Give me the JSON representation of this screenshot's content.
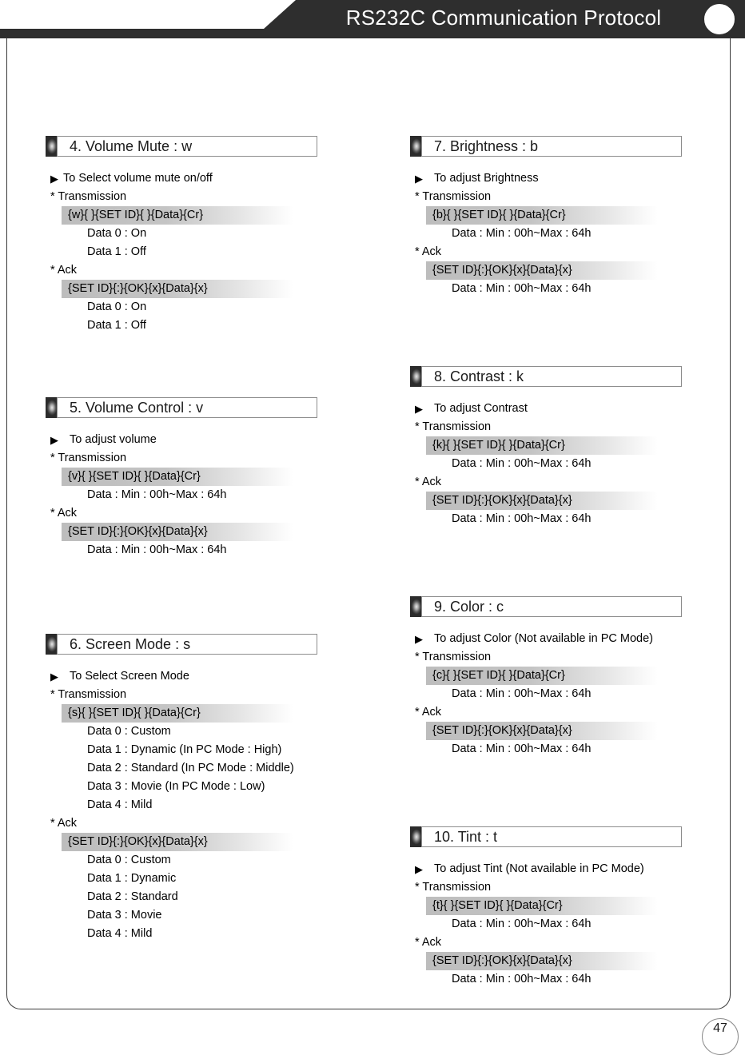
{
  "header": {
    "title": "RS232C Communication Protocol",
    "circle_icon": "circle-icon"
  },
  "page_number": "47",
  "left_column": [
    {
      "heading": "4. Volume Mute : w",
      "arrow_icon": "▶",
      "purpose": "To Select volume mute on/off",
      "transmission_label": "* Transmission",
      "transmission_command": "{w}{ }{SET ID}{ }{Data}{Cr}",
      "transmission_data": [
        "Data 0 : On",
        "Data 1 : Off"
      ],
      "ack_label": "* Ack",
      "ack_command": "{SET ID}{:}{OK}{x}{Data}{x}",
      "ack_data": [
        "Data 0 : On",
        "Data 1 : Off"
      ]
    },
    {
      "heading": "5. Volume Control : v",
      "arrow_icon": "▶",
      "purpose": "To adjust volume",
      "transmission_label": "* Transmission",
      "transmission_command": "{v}{ }{SET ID}{ }{Data}{Cr}",
      "transmission_data": [
        "Data : Min : 00h~Max : 64h"
      ],
      "ack_label": "* Ack",
      "ack_command": "{SET ID}{:}{OK}{x}{Data}{x}",
      "ack_data": [
        "Data : Min : 00h~Max : 64h"
      ]
    },
    {
      "heading": "6. Screen Mode : s",
      "arrow_icon": "▶",
      "purpose": "To Select Screen Mode",
      "transmission_label": "* Transmission",
      "transmission_command": "{s}{ }{SET ID}{ }{Data}{Cr}",
      "transmission_data": [
        "Data 0 : Custom",
        "Data 1 : Dynamic (In PC Mode : High)",
        "Data 2 : Standard (In PC Mode : Middle)",
        "Data 3 : Movie (In PC Mode : Low)",
        "Data 4 : Mild"
      ],
      "ack_label": "* Ack",
      "ack_command": "{SET ID}{:}{OK}{x}{Data}{x}",
      "ack_data": [
        "Data 0 : Custom",
        "Data 1 : Dynamic",
        "Data 2 : Standard",
        "Data 3 : Movie",
        "Data 4 : Mild"
      ]
    }
  ],
  "right_column": [
    {
      "heading": "7. Brightness : b",
      "arrow_icon": "▶",
      "purpose": "To adjust Brightness",
      "transmission_label": "* Transmission",
      "transmission_command": "{b}{ }{SET ID}{ }{Data}{Cr}",
      "transmission_data": [
        "Data : Min : 00h~Max : 64h"
      ],
      "ack_label": "* Ack",
      "ack_command": "{SET ID}{:}{OK}{x}{Data}{x}",
      "ack_data": [
        "Data : Min : 00h~Max : 64h"
      ]
    },
    {
      "heading": "8. Contrast : k",
      "arrow_icon": "▶",
      "purpose": "To adjust Contrast",
      "transmission_label": "* Transmission",
      "transmission_command": "{k}{ }{SET ID}{ }{Data}{Cr}",
      "transmission_data": [
        "Data : Min : 00h~Max : 64h"
      ],
      "ack_label": "* Ack",
      "ack_command": "{SET ID}{:}{OK}{x}{Data}{x}",
      "ack_data": [
        "Data : Min : 00h~Max : 64h"
      ]
    },
    {
      "heading": "9. Color : c",
      "arrow_icon": "▶",
      "purpose": "To adjust Color (Not available in PC Mode)",
      "transmission_label": "* Transmission",
      "transmission_command": "{c}{ }{SET ID}{ }{Data}{Cr}",
      "transmission_data": [
        "Data : Min : 00h~Max : 64h"
      ],
      "ack_label": "* Ack",
      "ack_command": "{SET ID}{:}{OK}{x}{Data}{x}",
      "ack_data": [
        "Data : Min : 00h~Max : 64h"
      ]
    },
    {
      "heading": "10. Tint : t",
      "arrow_icon": "▶",
      "purpose": "To adjust Tint (Not available in PC Mode)",
      "transmission_label": "* Transmission",
      "transmission_command": "{t}{ }{SET ID}{ }{Data}{Cr}",
      "transmission_data": [
        "Data : Min : 00h~Max : 64h"
      ],
      "ack_label": "* Ack",
      "ack_command": "{SET ID}{:}{OK}{x}{Data}{x}",
      "ack_data": [
        "Data : Min : 00h~Max : 64h"
      ]
    }
  ],
  "colors": {
    "header_bar": "#2e2e2e",
    "frame_border": "#3a3a3a",
    "command_highlight": "#bdbdbd"
  }
}
